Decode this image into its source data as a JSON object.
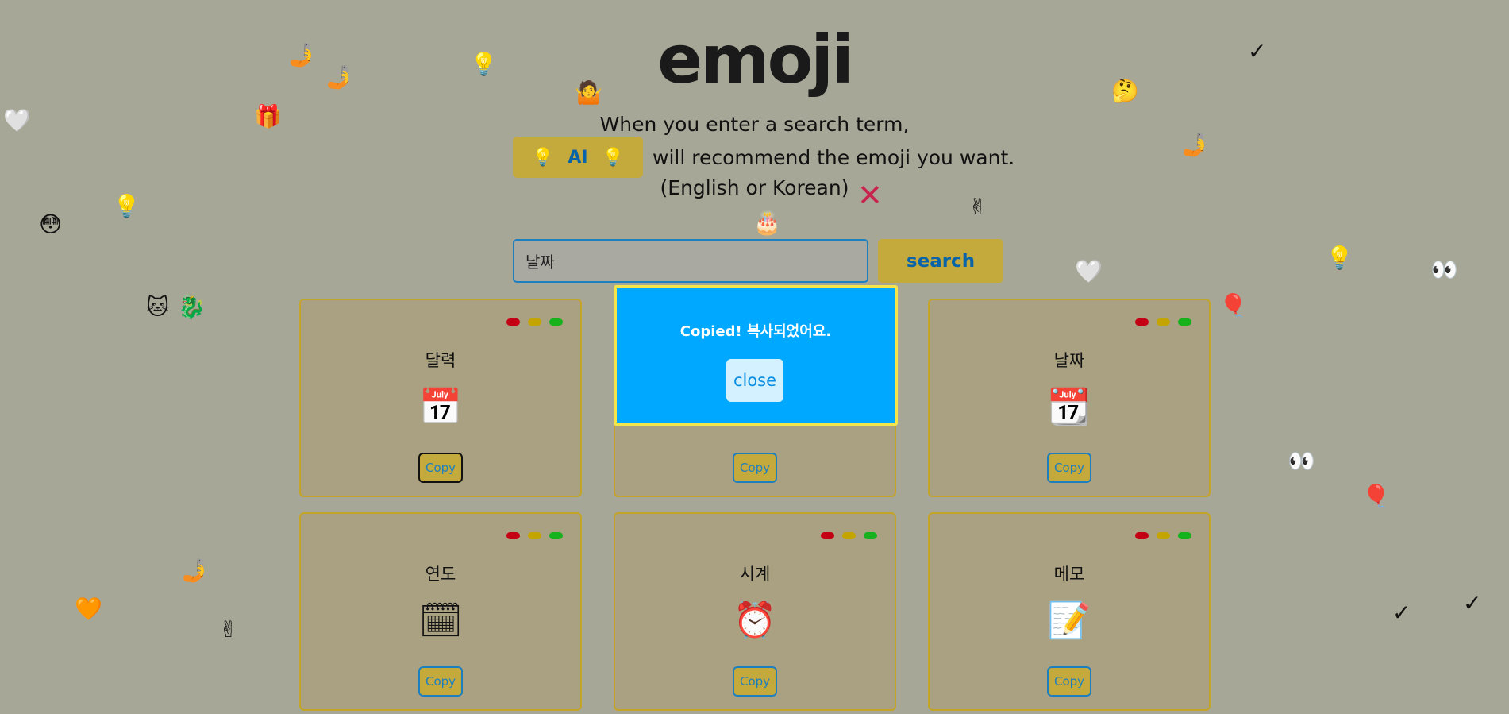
{
  "logo": "emoji",
  "intro": {
    "line1": "When you enter a search term,",
    "ai_label": "AI",
    "ai_icon": "💡",
    "line2": "will recommend the emoji you want.",
    "line3": "(English or Korean)",
    "close_mark": "✕"
  },
  "search": {
    "value": "날짜",
    "button": "search"
  },
  "cards": [
    {
      "title": "달력",
      "emoji": "📅",
      "copy": "Copy"
    },
    {
      "title": "",
      "emoji": "",
      "copy": "Copy"
    },
    {
      "title": "날짜",
      "emoji": "📆",
      "copy": "Copy"
    },
    {
      "title": "연도",
      "emoji": "🗓",
      "copy": "Copy"
    },
    {
      "title": "시계",
      "emoji": "⏰",
      "copy": "Copy"
    },
    {
      "title": "메모",
      "emoji": "📝",
      "copy": "Copy"
    }
  ],
  "modal": {
    "message": "Copied! 복사되었어요.",
    "close": "close"
  },
  "decorations": [
    "🤳",
    "🤳",
    "💡",
    "🤷",
    "🤔",
    "✓",
    "🤍",
    "🎁",
    "🤳",
    "😳",
    "💡",
    "✌",
    "🎂",
    "🤍",
    "💡",
    "👀",
    "🐱",
    "🐉",
    "🎈",
    "👀",
    "🎈",
    "🤳",
    "🧡",
    "✌",
    "✓",
    "✓"
  ]
}
